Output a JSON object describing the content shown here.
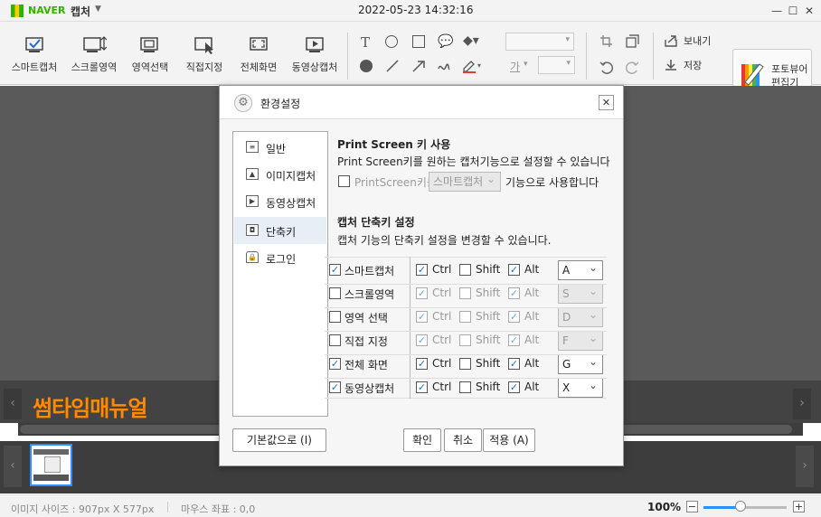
{
  "app": {
    "brand": "NAVER",
    "product": "캡처",
    "datetime": "2022-05-23 14:32:16",
    "window_buttons": [
      "minimize",
      "maximize",
      "close"
    ]
  },
  "toolbar": {
    "tools": [
      {
        "label": "스마트캡처",
        "icon": "smart-capture-icon"
      },
      {
        "label": "스크롤영역",
        "icon": "scroll-capture-icon"
      },
      {
        "label": "영역선택",
        "icon": "area-select-icon"
      },
      {
        "label": "직접지정",
        "icon": "direct-select-icon"
      },
      {
        "label": "전체화면",
        "icon": "fullscreen-icon"
      },
      {
        "label": "동영상캡처",
        "icon": "video-capture-icon"
      }
    ],
    "font_glyph": "가",
    "send_label": "보내기",
    "save_label": "저장",
    "viewer_label_line1": "포토뷰어",
    "viewer_label_line2": "편집기"
  },
  "canvas": {
    "watermark": "썸타임매뉴얼"
  },
  "status": {
    "image_size": "이미지 사이즈 : 907px X 577px",
    "mouse_coord": "마우스 좌표 : 0,0",
    "zoom": "100%",
    "zoom_level": 0.45
  },
  "dialog": {
    "title": "환경설정",
    "nav": [
      {
        "label": "일반",
        "icon": "general-settings-icon"
      },
      {
        "label": "이미지캡처",
        "icon": "image-capture-icon"
      },
      {
        "label": "동영상캡처",
        "icon": "video-capture-icon"
      },
      {
        "label": "단축키",
        "icon": "shortcut-key-icon",
        "active": true
      },
      {
        "label": "로그인",
        "icon": "lock-icon"
      }
    ],
    "printscreen": {
      "heading": "Print Screen 키 사용",
      "desc": "Print Screen키를 원하는 캡처기능으로 설정할 수 있습니다",
      "checkbox_label": "PrintScreen키를",
      "select_value": "스마트캡처",
      "suffix": "기능으로 사용합니다",
      "checked": false
    },
    "shortcut": {
      "heading": "캡처 단축키 설정",
      "desc": "캡처 기능의 단축키 설정을 변경할 수 있습니다.",
      "ctrl_label": "Ctrl",
      "shift_label": "Shift",
      "alt_label": "Alt",
      "rows": [
        {
          "label": "스마트캡처",
          "enabled": true,
          "ctrl": true,
          "shift": false,
          "alt": true,
          "key": "A"
        },
        {
          "label": "스크롤영역",
          "enabled": false,
          "ctrl": true,
          "shift": false,
          "alt": true,
          "key": "S"
        },
        {
          "label": "영역 선택",
          "enabled": false,
          "ctrl": true,
          "shift": false,
          "alt": true,
          "key": "D"
        },
        {
          "label": "직접 지정",
          "enabled": false,
          "ctrl": true,
          "shift": false,
          "alt": true,
          "key": "F"
        },
        {
          "label": "전체 화면",
          "enabled": true,
          "ctrl": true,
          "shift": false,
          "alt": true,
          "key": "G"
        },
        {
          "label": "동영상캡처",
          "enabled": true,
          "ctrl": true,
          "shift": false,
          "alt": true,
          "key": "X"
        }
      ]
    },
    "buttons": {
      "default": "기본값으로 (I)",
      "ok": "확인",
      "cancel": "취소",
      "apply": "적용 (A)"
    }
  }
}
